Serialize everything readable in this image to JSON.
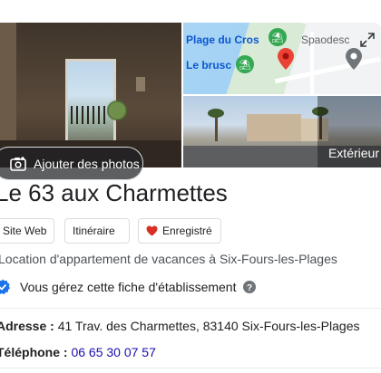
{
  "gallery": {
    "add_photos_label": "Ajouter des photos",
    "exterior_label": "Extérieur"
  },
  "map": {
    "labels": {
      "plage_du_cros": "Plage du Cros",
      "le_brusc": "Le brusc",
      "spaodes": "Spaodesc"
    }
  },
  "business": {
    "name": "Le 63 aux Charmettes",
    "category": "Location d'appartement de vacances à Six-Fours-les-Plages",
    "verified_text": "Vous gérez cette fiche d'établissement"
  },
  "actions": {
    "website": "Site Web",
    "route": "Itinéraire",
    "save": "Enregistré"
  },
  "info": {
    "address_key": "Adresse :",
    "address_value": "41 Trav. des Charmettes, 83140 Six-Fours-les-Plages",
    "phone_key": "Téléphone :",
    "phone_value": "06 65 30 07 57"
  },
  "colors": {
    "link": "#1a0dab",
    "verified_blue": "#1a73e8",
    "save_heart": "#d93025",
    "map_pin": "#ea4335",
    "poi_green": "#34a853"
  },
  "icons": {
    "add_photo": "camera-plus-icon",
    "expand": "expand-icon",
    "pin": "map-pin-icon",
    "heart": "heart-icon",
    "verified": "verified-check-icon",
    "help": "help-circle-icon"
  }
}
